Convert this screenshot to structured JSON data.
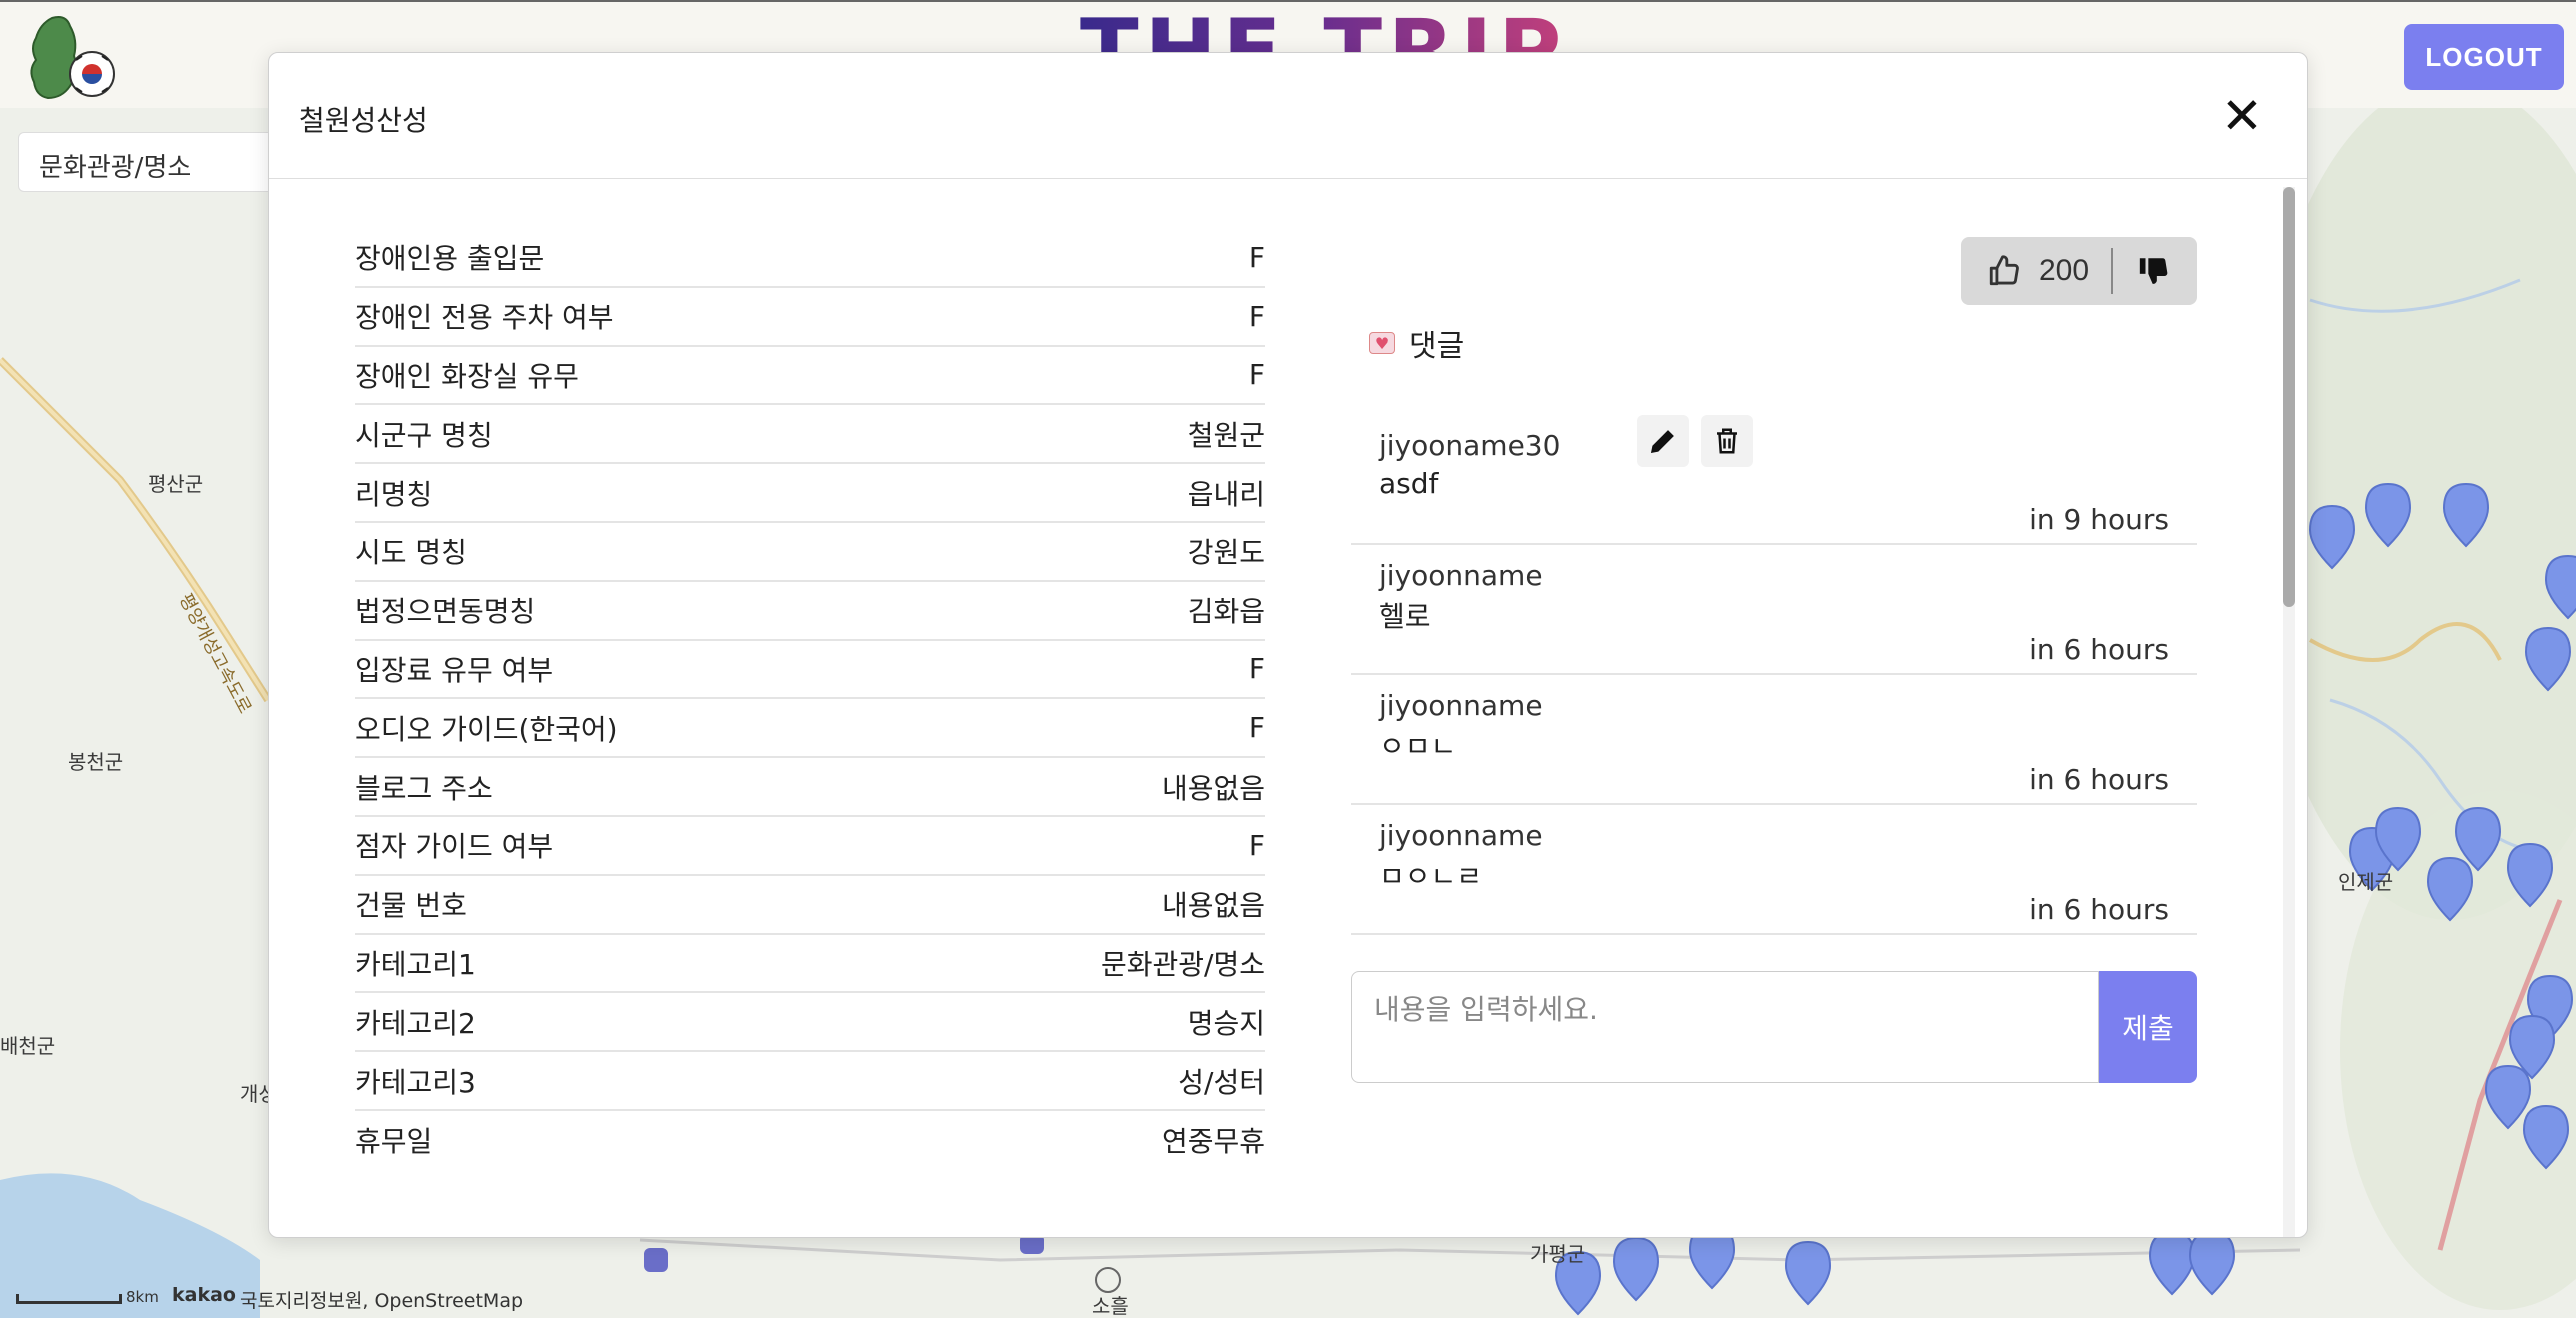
{
  "app": {
    "brand": "THE TRIP",
    "logout_label": "LOGOUT",
    "category_selected": "문화관광/명소"
  },
  "map": {
    "place_labels": [
      "평산군",
      "봉천군",
      "배천군",
      "개성",
      "인제군",
      "가평군",
      "소흘"
    ],
    "road_label": "평양개성고속도로",
    "attribution": {
      "scale": "8km",
      "kakao": "kakao",
      "credit": "국토지리정보원, OpenStreetMap"
    }
  },
  "modal": {
    "title": "철원성산성",
    "close_label": "✕",
    "info": [
      {
        "key": "장애인용 출입문",
        "value": "F"
      },
      {
        "key": "장애인 전용 주차 여부",
        "value": "F"
      },
      {
        "key": "장애인 화장실 유무",
        "value": "F"
      },
      {
        "key": "시군구 명칭",
        "value": "철원군"
      },
      {
        "key": "리명칭",
        "value": "읍내리"
      },
      {
        "key": "시도 명칭",
        "value": "강원도"
      },
      {
        "key": "법정으면동명칭",
        "value": "김화읍"
      },
      {
        "key": "입장료 유무 여부",
        "value": "F"
      },
      {
        "key": "오디오 가이드(한국어)",
        "value": "F"
      },
      {
        "key": "블로그 주소",
        "value": "내용없음"
      },
      {
        "key": "점자 가이드 여부",
        "value": "F"
      },
      {
        "key": "건물 번호",
        "value": "내용없음"
      },
      {
        "key": "카테고리1",
        "value": "문화관광/명소"
      },
      {
        "key": "카테고리2",
        "value": "명승지"
      },
      {
        "key": "카테고리3",
        "value": "성/성터"
      },
      {
        "key": "휴무일",
        "value": "연중무휴"
      }
    ],
    "vote": {
      "like_count": "200"
    },
    "comments_heading": "댓글",
    "comments": [
      {
        "author": "jiyooname30",
        "body": "asdf",
        "time": "in 9 hours",
        "editable": true
      },
      {
        "author": "jiyoonname",
        "body": "헬로",
        "time": "in 6 hours",
        "editable": false
      },
      {
        "author": "jiyoonname",
        "body": "ㅇㅁㄴ",
        "time": "in 6 hours",
        "editable": false
      },
      {
        "author": "jiyoonname",
        "body": "ㅁㅇㄴㄹ",
        "time": "in 6 hours",
        "editable": false
      }
    ],
    "comment_input": {
      "placeholder": "내용을 입력하세요.",
      "value": ""
    },
    "submit_label": "제출"
  },
  "colors": {
    "accent": "#7b7fef",
    "marker": "#7b95e8",
    "brand_start": "#3a2a8c",
    "brand_end": "#c2407b"
  }
}
